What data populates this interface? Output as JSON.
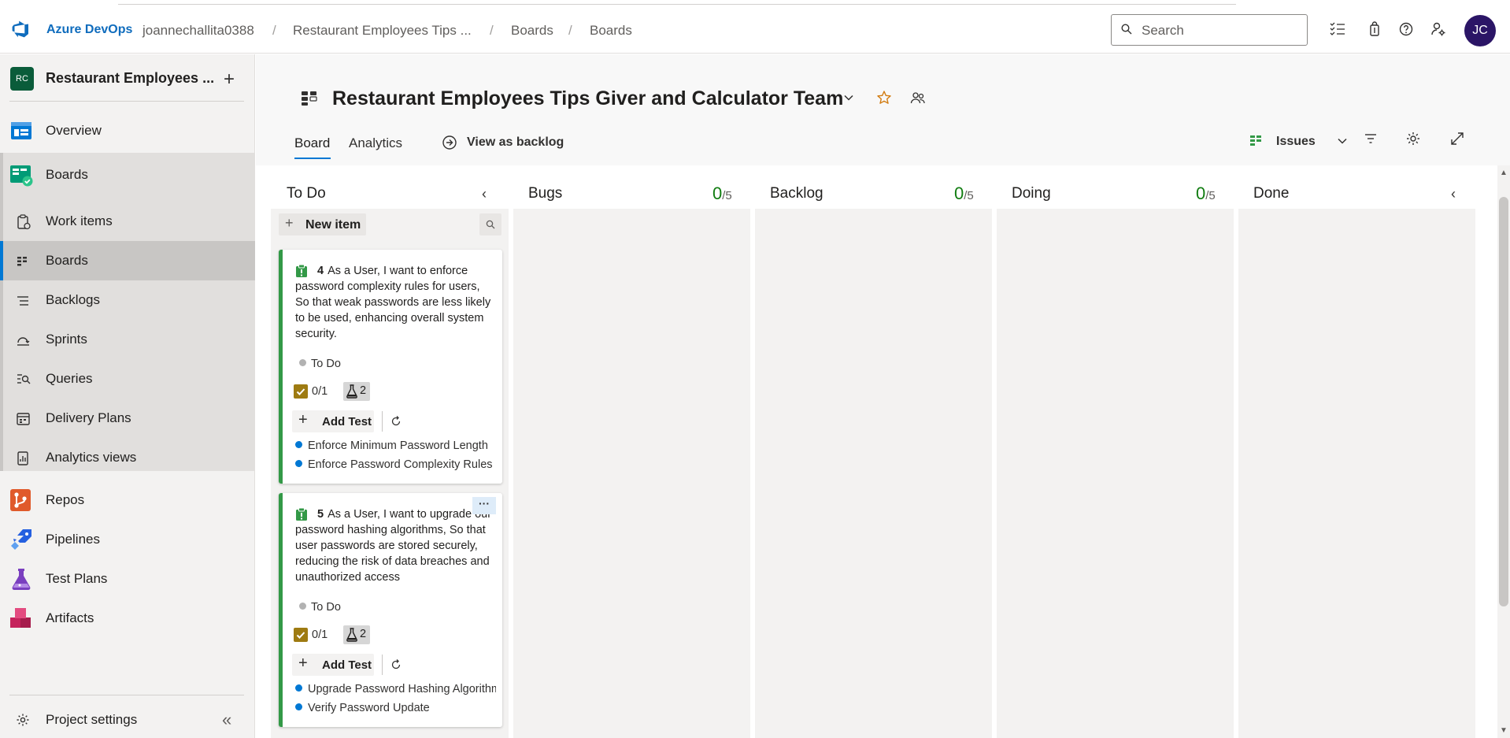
{
  "topbar": {
    "brand": "Azure DevOps",
    "breadcrumbs": [
      "joannechallita0388",
      "Restaurant Employees Tips ...",
      "Boards",
      "Boards"
    ],
    "separators": [
      "/",
      "/",
      "/"
    ],
    "search_placeholder": "Search",
    "avatar_initials": "JC",
    "colors": {
      "brand": "#0f6cbd",
      "avatar": "#2b1566"
    }
  },
  "sidebar": {
    "project_badge": "RC",
    "project_name": "Restaurant Employees ...",
    "add_label": "+",
    "items": [
      {
        "label": "Overview",
        "icon": "overview-icon"
      },
      {
        "label": "Boards",
        "icon": "boards-icon"
      },
      {
        "label": "Repos",
        "icon": "repos-icon"
      },
      {
        "label": "Pipelines",
        "icon": "pipelines-icon"
      },
      {
        "label": "Test Plans",
        "icon": "test-plans-icon"
      },
      {
        "label": "Artifacts",
        "icon": "artifacts-icon"
      }
    ],
    "boards_sub": [
      {
        "label": "Work items",
        "icon": "work-items-icon"
      },
      {
        "label": "Boards",
        "icon": "boards-sub-icon",
        "selected": true
      },
      {
        "label": "Backlogs",
        "icon": "backlogs-icon"
      },
      {
        "label": "Sprints",
        "icon": "sprints-icon"
      },
      {
        "label": "Queries",
        "icon": "queries-icon"
      },
      {
        "label": "Delivery Plans",
        "icon": "delivery-plans-icon"
      },
      {
        "label": "Analytics views",
        "icon": "analytics-views-icon"
      }
    ],
    "settings_label": "Project settings",
    "collapse_label": "«"
  },
  "header": {
    "team_title": "Restaurant Employees Tips Giver and Calculator Team",
    "tabs": [
      "Board",
      "Analytics"
    ],
    "view_as_backlog": "View as backlog",
    "backlog_level": "Issues"
  },
  "board": {
    "columns": [
      {
        "name": "To Do",
        "count": "",
        "limit": ""
      },
      {
        "name": "Bugs",
        "count": "0",
        "limit": "/5"
      },
      {
        "name": "Backlog",
        "count": "0",
        "limit": "/5"
      },
      {
        "name": "Doing",
        "count": "0",
        "limit": "/5"
      },
      {
        "name": "Done",
        "count": "",
        "limit": ""
      }
    ],
    "new_item_label": "New item",
    "collapse_arrow": "‹",
    "cards": [
      {
        "id": "4",
        "title": "As a User, I want to enforce password complexity rules for users, So that weak passwords are less likely to be used, enhancing overall system security.",
        "state": "To Do",
        "checklist": "0/1",
        "tests": "2",
        "add_test_label": "Add Test",
        "children": [
          "Enforce Minimum Password Length",
          "Enforce Password Complexity Rules"
        ]
      },
      {
        "id": "5",
        "title": "As a User, I want to upgrade our password hashing algorithms, So that user passwords are stored securely, reducing the risk of data breaches and unauthorized access",
        "state": "To Do",
        "checklist": "0/1",
        "tests": "2",
        "add_test_label": "Add Test",
        "more_label": "···",
        "children": [
          "Upgrade Password Hashing Algorithms",
          "Verify Password Update"
        ]
      }
    ],
    "colors": {
      "story_stripe": "#339947",
      "count": "#107c10",
      "child_dot": "#0078d4",
      "checklist": "#9e7b12"
    }
  }
}
